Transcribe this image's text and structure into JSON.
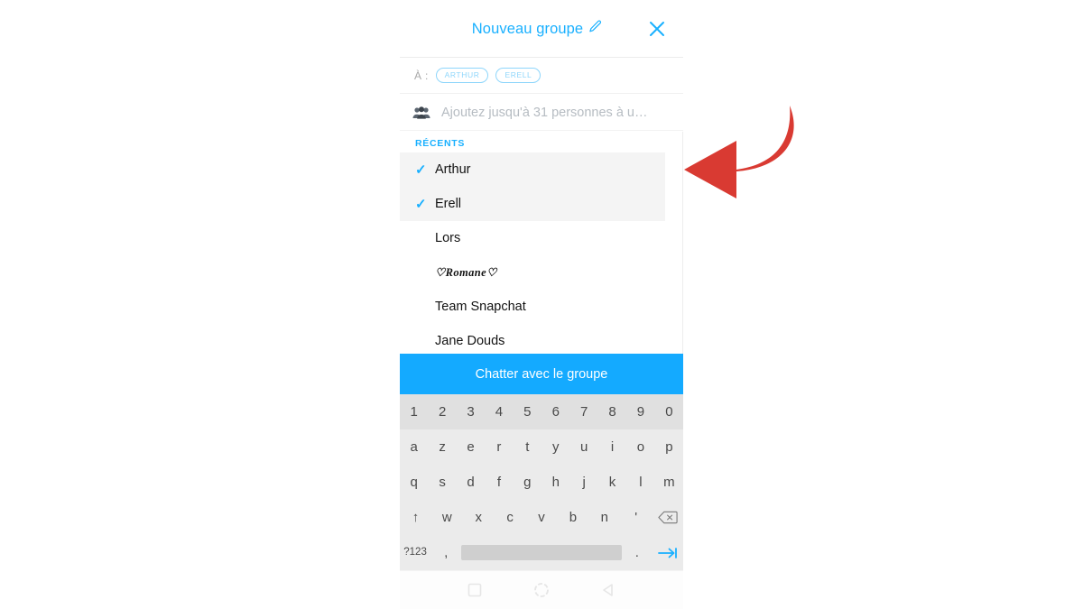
{
  "colors": {
    "accent_blue": "#19B0FF",
    "cta_blue": "#14AAFF",
    "chip_blue": "#8ed6fb",
    "hint_gray": "#b6bcc2",
    "selected_row_bg": "#f4f4f4",
    "keyboard_bg": "#ebebeb",
    "number_row_bg": "#e0e0e0",
    "spacebar_gray": "#cfcfcf",
    "annotation_red": "#D93A32"
  },
  "header": {
    "title": "Nouveau groupe",
    "edit_icon": "pencil-icon",
    "close_icon": "close-icon"
  },
  "recipients": {
    "to_label": "À :",
    "chips": [
      {
        "label": "ARTHUR"
      },
      {
        "label": "ERELL"
      }
    ]
  },
  "add_people": {
    "icon": "group-people-icon",
    "hint": "Ajoutez jusqu'à 31 personnes à u…"
  },
  "contacts": {
    "section_label": "RÉCENTS",
    "items": [
      {
        "name": "Arthur",
        "selected": true,
        "script": false
      },
      {
        "name": "Erell",
        "selected": true,
        "script": false
      },
      {
        "name": "Lors",
        "selected": false,
        "script": false
      },
      {
        "name": "♡Romane♡",
        "selected": false,
        "script": true
      },
      {
        "name": "Team Snapchat",
        "selected": false,
        "script": false
      },
      {
        "name": "Jane Douds",
        "selected": false,
        "script": false
      }
    ],
    "check_glyph": "✓"
  },
  "cta": {
    "label": "Chatter avec le groupe"
  },
  "keyboard": {
    "layout": "azerty",
    "rows": [
      {
        "name": "numbers",
        "keys": [
          {
            "label": "1"
          },
          {
            "label": "2"
          },
          {
            "label": "3"
          },
          {
            "label": "4"
          },
          {
            "label": "5"
          },
          {
            "label": "6"
          },
          {
            "label": "7"
          },
          {
            "label": "8"
          },
          {
            "label": "9"
          },
          {
            "label": "0"
          }
        ]
      },
      {
        "name": "top",
        "keys": [
          {
            "label": "a"
          },
          {
            "label": "z"
          },
          {
            "label": "e"
          },
          {
            "label": "r"
          },
          {
            "label": "t"
          },
          {
            "label": "y"
          },
          {
            "label": "u"
          },
          {
            "label": "i"
          },
          {
            "label": "o"
          },
          {
            "label": "p"
          }
        ]
      },
      {
        "name": "home",
        "keys": [
          {
            "label": "q"
          },
          {
            "label": "s"
          },
          {
            "label": "d"
          },
          {
            "label": "f"
          },
          {
            "label": "g"
          },
          {
            "label": "h"
          },
          {
            "label": "j"
          },
          {
            "label": "k"
          },
          {
            "label": "l"
          },
          {
            "label": "m"
          }
        ]
      },
      {
        "name": "bottom",
        "keys": [
          {
            "label": "↑",
            "icon": "shift-icon"
          },
          {
            "label": "w"
          },
          {
            "label": "x"
          },
          {
            "label": "c"
          },
          {
            "label": "v"
          },
          {
            "label": "b"
          },
          {
            "label": "n"
          },
          {
            "label": "'"
          },
          {
            "label": "",
            "icon": "backspace-icon"
          }
        ]
      }
    ],
    "bottom_row": {
      "symbols_label": "?123",
      "comma_label": ",",
      "space_label": "",
      "period_label": ".",
      "tab_icon": "tab-next-icon"
    }
  },
  "navbar": {
    "recents_icon": "square-recents-icon",
    "home_icon": "circle-home-icon",
    "back_icon": "triangle-back-icon"
  },
  "annotation": {
    "arrow_icon": "curved-left-arrow-icon",
    "color": "#D93A32"
  }
}
